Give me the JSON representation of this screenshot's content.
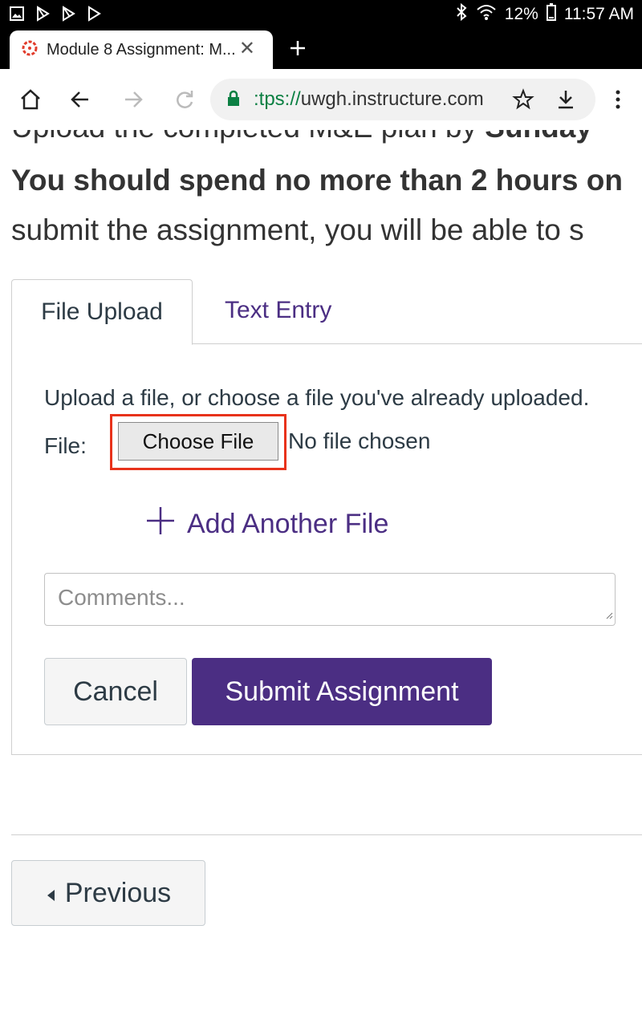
{
  "status_bar": {
    "battery": "12%",
    "time": "11:57 AM"
  },
  "browser": {
    "tab_title": "Module 8 Assignment: M...",
    "url_scheme": ":tps://",
    "url_host": "uwgh.instructure.com",
    "accent_color": "#0b8043"
  },
  "page": {
    "intro_line1_prefix": "Upload the completed M&E plan by ",
    "intro_line1_bold": "Sunday",
    "intro_line2": "You should spend no more than 2 hours on",
    "intro_line3": "submit the assignment, you will be able to s",
    "tabs": {
      "file_upload": "File Upload",
      "text_entry": "Text Entry"
    },
    "upload": {
      "note": "Upload a file, or choose a file you've already uploaded.",
      "file_label": "File:",
      "choose_file": "Choose File",
      "no_file": "No file chosen",
      "add_another": "Add Another File",
      "comments_placeholder": "Comments..."
    },
    "buttons": {
      "cancel": "Cancel",
      "submit": "Submit Assignment",
      "previous": "Previous"
    },
    "colors": {
      "brand_purple": "#4b2e83",
      "highlight_red": "#e8321b"
    }
  }
}
